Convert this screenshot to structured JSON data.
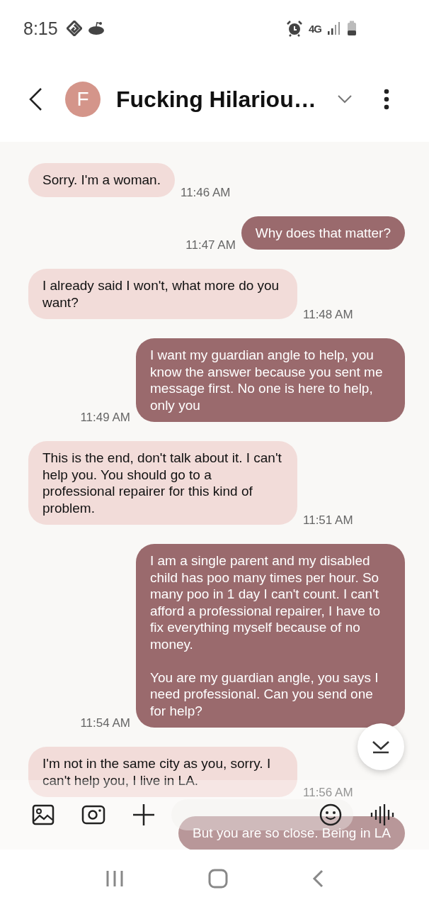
{
  "status_bar": {
    "time": "8:15",
    "network": "4G"
  },
  "header": {
    "avatar_letter": "F",
    "title": "Fucking Hilariou…"
  },
  "messages": [
    {
      "kind": "received",
      "text": "Sorry. I'm a woman.",
      "time": "11:46 AM"
    },
    {
      "kind": "sent",
      "text": "Why does that matter?",
      "time": "11:47 AM"
    },
    {
      "kind": "received",
      "text": "I already said I won't, what more do you want?",
      "time": "11:48 AM"
    },
    {
      "kind": "sent",
      "text": "I want my guardian angle to help, you know the answer because you sent me message first. No one is here to help, only you",
      "time": "11:49 AM"
    },
    {
      "kind": "received",
      "text": "This is the end, don't talk about it. I can't help you. You should go to a professional repairer for this kind of problem.",
      "time": "11:51 AM"
    },
    {
      "kind": "sent",
      "text": "I am a single parent and my disabled child has poo many times per hour. So many poo in 1 day I can't count. I can't afford a professional repairer, I have to fix everything myself because of no money.\n\nYou are my guardian angle, you says I need professional. Can you send one for help?",
      "time": "11:54 AM"
    },
    {
      "kind": "received",
      "text": "I'm not in the same city as you, sorry. I can't help you, I live in LA.",
      "time": "11:56 AM"
    },
    {
      "kind": "sent",
      "text": "But you are so close. Being in LA"
    }
  ]
}
